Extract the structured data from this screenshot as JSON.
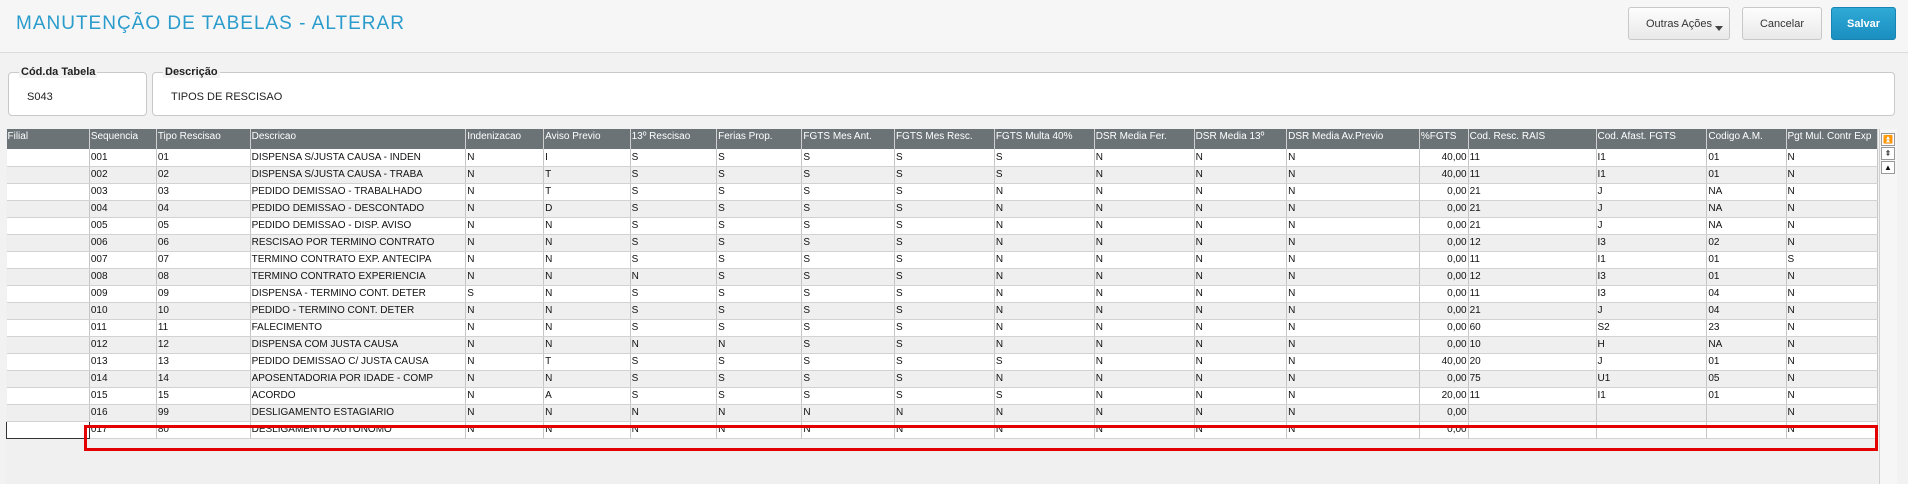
{
  "header": {
    "title": "MANUTENÇÃO DE TABELAS - ALTERAR",
    "buttons": {
      "outras": "Outras Ações",
      "cancelar": "Cancelar",
      "salvar": "Salvar"
    }
  },
  "form": {
    "cod_label": "Cód.da Tabela",
    "cod_value": "S043",
    "desc_label": "Descrição",
    "desc_value": "TIPOS DE RESCISAO"
  },
  "table": {
    "columns": [
      "Filial",
      "Sequencia",
      "Tipo Rescisao",
      "Descricao",
      "Indenizacao",
      "Aviso Previo",
      "13º Rescisao",
      "Ferias Prop.",
      "FGTS Mes Ant.",
      "FGTS Mes Resc.",
      "FGTS Multa 40%",
      "DSR Media Fer.",
      "DSR Media 13º",
      "DSR Media Av.Previo",
      "%FGTS",
      "Cod. Resc. RAIS",
      "Cod. Afast. FGTS",
      "Codigo A.M.",
      "Pgt Mul. Contr Exp"
    ],
    "rows": [
      [
        "",
        "001",
        "01",
        "DISPENSA S/JUSTA CAUSA - INDEN",
        "N",
        "I",
        "S",
        "S",
        "S",
        "S",
        "S",
        "N",
        "N",
        "N",
        "40,00",
        "11",
        "I1",
        "01",
        "N"
      ],
      [
        "",
        "002",
        "02",
        "DISPENSA S/JUSTA CAUSA - TRABA",
        "N",
        "T",
        "S",
        "S",
        "S",
        "S",
        "S",
        "N",
        "N",
        "N",
        "40,00",
        "11",
        "I1",
        "01",
        "N"
      ],
      [
        "",
        "003",
        "03",
        "PEDIDO DEMISSAO - TRABALHADO",
        "N",
        "T",
        "S",
        "S",
        "S",
        "S",
        "N",
        "N",
        "N",
        "N",
        "0,00",
        "21",
        "J",
        "NA",
        "N"
      ],
      [
        "",
        "004",
        "04",
        "PEDIDO DEMISSAO - DESCONTADO",
        "N",
        "D",
        "S",
        "S",
        "S",
        "S",
        "N",
        "N",
        "N",
        "N",
        "0,00",
        "21",
        "J",
        "NA",
        "N"
      ],
      [
        "",
        "005",
        "05",
        "PEDIDO DEMISSAO - DISP. AVISO",
        "N",
        "N",
        "S",
        "S",
        "S",
        "S",
        "N",
        "N",
        "N",
        "N",
        "0,00",
        "21",
        "J",
        "NA",
        "N"
      ],
      [
        "",
        "006",
        "06",
        "RESCISAO POR TERMINO CONTRATO",
        "N",
        "N",
        "S",
        "S",
        "S",
        "S",
        "N",
        "N",
        "N",
        "N",
        "0,00",
        "12",
        "I3",
        "02",
        "N"
      ],
      [
        "",
        "007",
        "07",
        "TERMINO CONTRATO EXP. ANTECIPA",
        "N",
        "N",
        "S",
        "S",
        "S",
        "S",
        "N",
        "N",
        "N",
        "N",
        "0,00",
        "11",
        "I1",
        "01",
        "S"
      ],
      [
        "",
        "008",
        "08",
        "TERMINO CONTRATO EXPERIENCIA",
        "N",
        "N",
        "N",
        "S",
        "S",
        "S",
        "N",
        "N",
        "N",
        "N",
        "0,00",
        "12",
        "I3",
        "01",
        "N"
      ],
      [
        "",
        "009",
        "09",
        "DISPENSA - TERMINO CONT. DETER",
        "S",
        "N",
        "S",
        "S",
        "S",
        "S",
        "N",
        "N",
        "N",
        "N",
        "0,00",
        "11",
        "I3",
        "04",
        "N"
      ],
      [
        "",
        "010",
        "10",
        "PEDIDO - TERMINO CONT. DETER",
        "N",
        "N",
        "S",
        "S",
        "S",
        "S",
        "N",
        "N",
        "N",
        "N",
        "0,00",
        "21",
        "J",
        "04",
        "N"
      ],
      [
        "",
        "011",
        "11",
        "FALECIMENTO",
        "N",
        "N",
        "S",
        "S",
        "S",
        "S",
        "N",
        "N",
        "N",
        "N",
        "0,00",
        "60",
        "S2",
        "23",
        "N"
      ],
      [
        "",
        "012",
        "12",
        "DISPENSA COM JUSTA CAUSA",
        "N",
        "N",
        "N",
        "N",
        "S",
        "S",
        "N",
        "N",
        "N",
        "N",
        "0,00",
        "10",
        "H",
        "NA",
        "N"
      ],
      [
        "",
        "013",
        "13",
        "PEDIDO DEMISSAO C/ JUSTA CAUSA",
        "N",
        "T",
        "S",
        "S",
        "S",
        "S",
        "S",
        "N",
        "N",
        "N",
        "40,00",
        "20",
        "J",
        "01",
        "N"
      ],
      [
        "",
        "014",
        "14",
        "APOSENTADORIA POR IDADE - COMP",
        "N",
        "N",
        "S",
        "S",
        "S",
        "S",
        "N",
        "N",
        "N",
        "N",
        "0,00",
        "75",
        "U1",
        "05",
        "N"
      ],
      [
        "",
        "015",
        "15",
        "ACORDO",
        "N",
        "A",
        "S",
        "S",
        "S",
        "S",
        "S",
        "N",
        "N",
        "N",
        "20,00",
        "11",
        "I1",
        "01",
        "N"
      ],
      [
        "",
        "016",
        "99",
        "DESLIGAMENTO ESTAGIARIO",
        "N",
        "N",
        "N",
        "N",
        "N",
        "N",
        "N",
        "N",
        "N",
        "N",
        "0,00",
        "",
        "",
        "",
        "N"
      ],
      [
        "",
        "017",
        "80",
        "DESLIGAMENTO AUTONOMO",
        "N",
        "N",
        "N",
        "N",
        "N",
        "N",
        "N",
        "N",
        "N",
        "N",
        "0,00",
        "",
        "",
        "",
        "N"
      ]
    ]
  },
  "scrollbar": {
    "top_icon": "scroll-top-icon",
    "up_fast_icon": "scroll-up-fast-icon",
    "up_icon": "scroll-up-icon"
  },
  "colors": {
    "title": "#2a9ccc",
    "primary": "#1a8fc0",
    "header_bg": "#6b7377",
    "highlight": "#e20000"
  }
}
